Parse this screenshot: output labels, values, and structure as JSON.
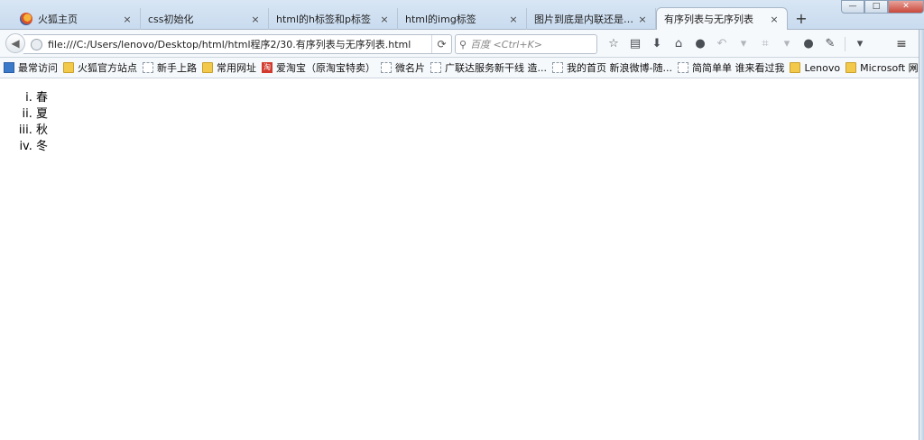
{
  "tabs": [
    {
      "label": "火狐主页",
      "active": false,
      "icon": "firefox-icon"
    },
    {
      "label": "css初始化",
      "active": false
    },
    {
      "label": "html的h标签和p标签",
      "active": false
    },
    {
      "label": "html的img标签",
      "active": false
    },
    {
      "label": "图片到底是内联还是块状",
      "active": false
    },
    {
      "label": "有序列表与无序列表",
      "active": true
    }
  ],
  "tab_close_glyph": "×",
  "new_tab_glyph": "+",
  "window_controls": {
    "minimize": "—",
    "maximize": "□",
    "close": "✕"
  },
  "address": {
    "url": "file:///C:/Users/lenovo/Desktop/html/html程序2/30.有序列表与无序列表.html"
  },
  "search": {
    "placeholder": "百度 <Ctrl+K>"
  },
  "bookmarks": [
    {
      "label": "最常访问",
      "icon": "blue"
    },
    {
      "label": "火狐官方站点",
      "icon": "folder"
    },
    {
      "label": "新手上路",
      "icon": "page"
    },
    {
      "label": "常用网址",
      "icon": "folder"
    },
    {
      "label": "爱淘宝（原淘宝特卖）",
      "icon": "red"
    },
    {
      "label": "微名片",
      "icon": "page"
    },
    {
      "label": "广联达服务新干线 造...",
      "icon": "page"
    },
    {
      "label": "我的首页 新浪微博-随...",
      "icon": "page"
    },
    {
      "label": "简简单单 谁来看过我",
      "icon": "page"
    },
    {
      "label": "Lenovo",
      "icon": "folder"
    },
    {
      "label": "Microsoft 网站",
      "icon": "folder"
    }
  ],
  "bookmarks_overflow": "»",
  "list_items": [
    "春",
    "夏",
    "秋",
    "冬"
  ]
}
